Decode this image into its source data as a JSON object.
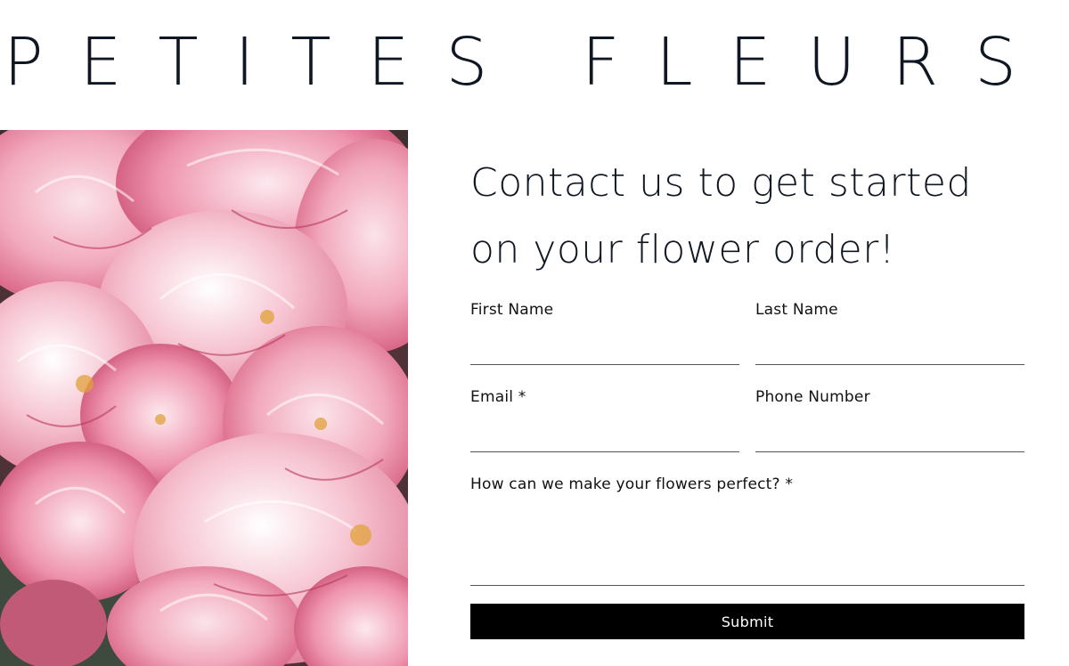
{
  "brand": {
    "name": "PETITES FLEURS"
  },
  "hero": {
    "image_alt": "pink peonies"
  },
  "form": {
    "heading_line1": "Contact us to get started",
    "heading_line2": "on your flower order!",
    "first_name_label": "First Name",
    "last_name_label": "Last Name",
    "email_label": "Email *",
    "phone_label": "Phone Number",
    "message_label": "How can we make your flowers perfect? *",
    "first_name_value": "",
    "last_name_value": "",
    "email_value": "",
    "phone_value": "",
    "message_value": "",
    "submit_label": "Submit"
  },
  "colors": {
    "brand_text": "#0f1722",
    "button_bg": "#000000",
    "button_text": "#ffffff",
    "peony_pink": "#e07a96"
  }
}
